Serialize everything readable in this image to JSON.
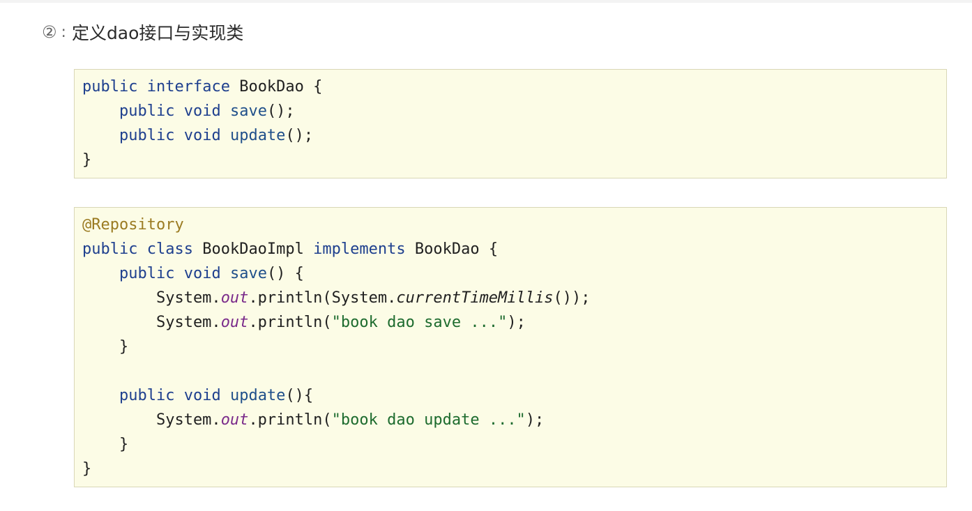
{
  "heading": {
    "number": "②",
    "separator": ":",
    "title": "定义dao接口与实现类"
  },
  "colors": {
    "code_background": "#fcfce6",
    "code_border": "#d9d7b6",
    "keyword": "#1e3f8e",
    "annotation": "#9b7b22",
    "field": "#7a2a8a",
    "string": "#1d6b2e"
  },
  "code_blocks": [
    {
      "lines": [
        [
          {
            "t": "public",
            "k": "keyword"
          },
          {
            "t": " ",
            "k": "plain"
          },
          {
            "t": "interface",
            "k": "keyword"
          },
          {
            "t": " BookDao {",
            "k": "plain"
          }
        ],
        [
          {
            "t": "    ",
            "k": "plain"
          },
          {
            "t": "public",
            "k": "keyword"
          },
          {
            "t": " ",
            "k": "plain"
          },
          {
            "t": "void",
            "k": "keyword"
          },
          {
            "t": " ",
            "k": "plain"
          },
          {
            "t": "save",
            "k": "method"
          },
          {
            "t": "();",
            "k": "plain"
          }
        ],
        [
          {
            "t": "    ",
            "k": "plain"
          },
          {
            "t": "public",
            "k": "keyword"
          },
          {
            "t": " ",
            "k": "plain"
          },
          {
            "t": "void",
            "k": "keyword"
          },
          {
            "t": " ",
            "k": "plain"
          },
          {
            "t": "update",
            "k": "method"
          },
          {
            "t": "();",
            "k": "plain"
          }
        ],
        [
          {
            "t": "}",
            "k": "plain"
          }
        ]
      ]
    },
    {
      "lines": [
        [
          {
            "t": "@Repository",
            "k": "annotation"
          }
        ],
        [
          {
            "t": "public",
            "k": "keyword"
          },
          {
            "t": " ",
            "k": "plain"
          },
          {
            "t": "class",
            "k": "keyword"
          },
          {
            "t": " BookDaoImpl ",
            "k": "plain"
          },
          {
            "t": "implements",
            "k": "keyword"
          },
          {
            "t": " BookDao {",
            "k": "plain"
          }
        ],
        [
          {
            "t": "    ",
            "k": "plain"
          },
          {
            "t": "public",
            "k": "keyword"
          },
          {
            "t": " ",
            "k": "plain"
          },
          {
            "t": "void",
            "k": "keyword"
          },
          {
            "t": " ",
            "k": "plain"
          },
          {
            "t": "save",
            "k": "method"
          },
          {
            "t": "() {",
            "k": "plain"
          }
        ],
        [
          {
            "t": "        System.",
            "k": "plain"
          },
          {
            "t": "out",
            "k": "field"
          },
          {
            "t": ".println(System.",
            "k": "plain"
          },
          {
            "t": "currentTimeMillis",
            "k": "static"
          },
          {
            "t": "());",
            "k": "plain"
          }
        ],
        [
          {
            "t": "        System.",
            "k": "plain"
          },
          {
            "t": "out",
            "k": "field"
          },
          {
            "t": ".println(",
            "k": "plain"
          },
          {
            "t": "\"book dao save ...\"",
            "k": "string"
          },
          {
            "t": ");",
            "k": "plain"
          }
        ],
        [
          {
            "t": "    }",
            "k": "plain"
          }
        ],
        [
          {
            "t": "",
            "k": "plain"
          }
        ],
        [
          {
            "t": "    ",
            "k": "plain"
          },
          {
            "t": "public",
            "k": "keyword"
          },
          {
            "t": " ",
            "k": "plain"
          },
          {
            "t": "void",
            "k": "keyword"
          },
          {
            "t": " ",
            "k": "plain"
          },
          {
            "t": "update",
            "k": "method"
          },
          {
            "t": "(){",
            "k": "plain"
          }
        ],
        [
          {
            "t": "        System.",
            "k": "plain"
          },
          {
            "t": "out",
            "k": "field"
          },
          {
            "t": ".println(",
            "k": "plain"
          },
          {
            "t": "\"book dao update ...\"",
            "k": "string"
          },
          {
            "t": ");",
            "k": "plain"
          }
        ],
        [
          {
            "t": "    }",
            "k": "plain"
          }
        ],
        [
          {
            "t": "}",
            "k": "plain"
          }
        ]
      ]
    }
  ]
}
